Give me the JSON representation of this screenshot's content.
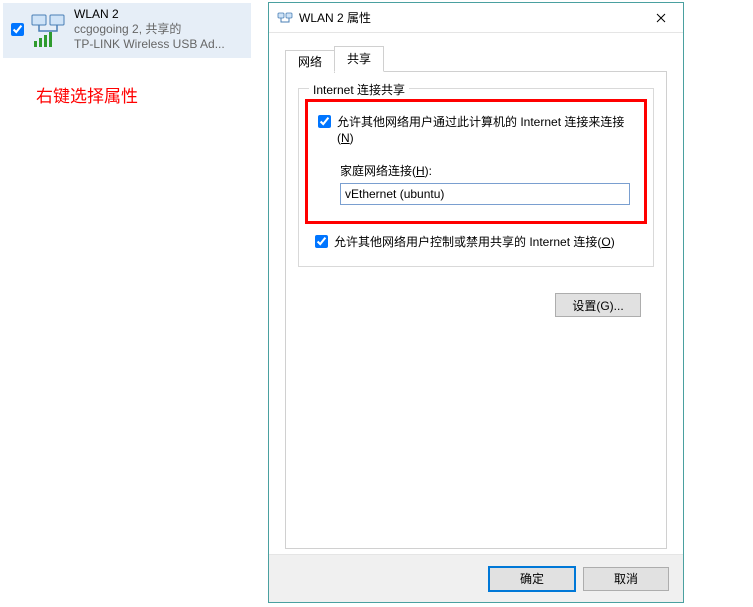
{
  "adapter": {
    "name": "WLAN 2",
    "ssid_line": "ccgogoing 2, 共享的",
    "driver_line": "TP-LINK Wireless USB Ad...",
    "checked": true
  },
  "annotation": "右键选择属性",
  "dialog": {
    "title": "WLAN 2 属性",
    "tabs": {
      "network": "网络",
      "sharing": "共享"
    },
    "fieldset_legend": "Internet 连接共享",
    "allow_connect": {
      "label_pre": "允许其他网络用户通过此计算机的 Internet 连接来连接(",
      "hotkey": "N",
      "label_post": ")",
      "checked": true
    },
    "home_network": {
      "label_pre": "家庭网络连接(",
      "hotkey": "H",
      "label_post": "):",
      "value": "vEthernet (ubuntu)"
    },
    "allow_control": {
      "label_pre": "允许其他网络用户控制或禁用共享的 Internet 连接(",
      "hotkey": "O",
      "label_post": ")",
      "checked": true
    },
    "settings_button": "设置(G)...",
    "ok_button": "确定",
    "cancel_button": "取消"
  }
}
